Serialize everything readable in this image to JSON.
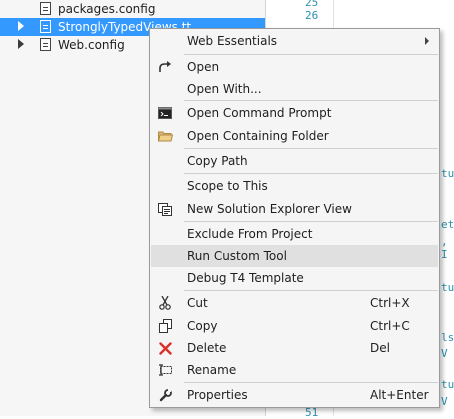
{
  "explorer": {
    "items": [
      {
        "label": "packages.config",
        "icon": "config-file-icon"
      },
      {
        "label": "StronglyTypedViews.tt",
        "icon": "tt-file-icon"
      },
      {
        "label": "Web.config",
        "icon": "config-file-icon"
      }
    ]
  },
  "editor": {
    "line_numbers": [
      "25",
      "26",
      "51"
    ],
    "fragments": [
      "tu",
      "et",
      ", I",
      "tu",
      "ls",
      "V",
      "tu",
      "V"
    ]
  },
  "menu": {
    "items": [
      {
        "label": "Web Essentials",
        "icon": "",
        "shortcut": "",
        "submenu": true
      },
      {
        "label": "Open",
        "icon": "open-arrow-icon",
        "shortcut": ""
      },
      {
        "label": "Open With...",
        "icon": "",
        "shortcut": ""
      },
      {
        "label": "Open Command Prompt",
        "icon": "command-prompt-icon",
        "shortcut": ""
      },
      {
        "label": "Open Containing Folder",
        "icon": "folder-icon",
        "shortcut": ""
      },
      {
        "label": "Copy Path",
        "icon": "",
        "shortcut": ""
      },
      {
        "label": "Scope to This",
        "icon": "",
        "shortcut": ""
      },
      {
        "label": "New Solution Explorer View",
        "icon": "solution-explorer-view-icon",
        "shortcut": ""
      },
      {
        "label": "Exclude From Project",
        "icon": "",
        "shortcut": ""
      },
      {
        "label": "Run Custom Tool",
        "icon": "",
        "shortcut": ""
      },
      {
        "label": "Debug T4 Template",
        "icon": "",
        "shortcut": ""
      },
      {
        "label": "Cut",
        "icon": "scissors-icon",
        "shortcut": "Ctrl+X"
      },
      {
        "label": "Copy",
        "icon": "copy-icon",
        "shortcut": "Ctrl+C"
      },
      {
        "label": "Delete",
        "icon": "delete-x-icon",
        "shortcut": "Del"
      },
      {
        "label": "Rename",
        "icon": "rename-icon",
        "shortcut": ""
      },
      {
        "label": "Properties",
        "icon": "wrench-icon",
        "shortcut": "Alt+Enter"
      }
    ]
  },
  "colors": {
    "selection": "#3399ff",
    "delete_icon": "#d9302c",
    "folder_icon": "#dcb67a"
  }
}
